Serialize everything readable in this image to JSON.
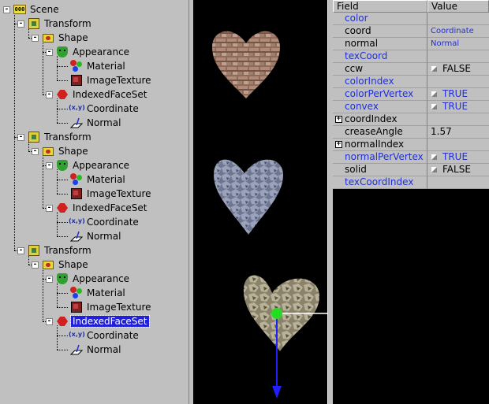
{
  "tree": {
    "nodes": [
      {
        "label": "Scene",
        "icon": "scene-icon",
        "expander": "-"
      },
      {
        "label": "Transform",
        "icon": "transform-icon",
        "expander": "-"
      },
      {
        "label": "Shape",
        "icon": "shape-icon",
        "expander": "-"
      },
      {
        "label": "Appearance",
        "icon": "appearance-icon",
        "expander": "-"
      },
      {
        "label": "Material",
        "icon": "material-icon"
      },
      {
        "label": "ImageTexture",
        "icon": "image-texture-icon"
      },
      {
        "label": "IndexedFaceSet",
        "icon": "indexed-face-set-icon",
        "expander": "-"
      },
      {
        "label": "Coordinate",
        "icon": "coordinate-icon"
      },
      {
        "label": "Normal",
        "icon": "normal-icon"
      },
      {
        "label": "Transform",
        "icon": "transform-icon",
        "expander": "-"
      },
      {
        "label": "Shape",
        "icon": "shape-icon",
        "expander": "-"
      },
      {
        "label": "Appearance",
        "icon": "appearance-icon",
        "expander": "-"
      },
      {
        "label": "Material",
        "icon": "material-icon"
      },
      {
        "label": "ImageTexture",
        "icon": "image-texture-icon"
      },
      {
        "label": "IndexedFaceSet",
        "icon": "indexed-face-set-icon",
        "expander": "-"
      },
      {
        "label": "Coordinate",
        "icon": "coordinate-icon"
      },
      {
        "label": "Normal",
        "icon": "normal-icon"
      },
      {
        "label": "Transform",
        "icon": "transform-icon",
        "expander": "-"
      },
      {
        "label": "Shape",
        "icon": "shape-icon",
        "expander": "-"
      },
      {
        "label": "Appearance",
        "icon": "appearance-icon",
        "expander": "-"
      },
      {
        "label": "Material",
        "icon": "material-icon"
      },
      {
        "label": "ImageTexture",
        "icon": "image-texture-icon"
      },
      {
        "label": "IndexedFaceSet",
        "icon": "indexed-face-set-icon",
        "expander": "-",
        "selected": true
      },
      {
        "label": "Coordinate",
        "icon": "coordinate-icon"
      },
      {
        "label": "Normal",
        "icon": "normal-icon"
      }
    ],
    "scene_icon_text": "000",
    "coordinate_icon_text": "(x,y)"
  },
  "viewer": {
    "objects": [
      "brick-heart",
      "slate-heart",
      "stone-heart"
    ],
    "selected_object": "stone-heart"
  },
  "fields": {
    "header_field": "Field",
    "header_value": "Value",
    "rows": [
      {
        "name": "color",
        "value": "",
        "blue": true
      },
      {
        "name": "coord",
        "value": "Coordinate",
        "value_blue": true,
        "value_small": true
      },
      {
        "name": "normal",
        "value": "Normal",
        "value_blue": true,
        "value_small": true
      },
      {
        "name": "texCoord",
        "value": "",
        "blue": true
      },
      {
        "name": "ccw",
        "value": "FALSE",
        "toggle": true
      },
      {
        "name": "colorIndex",
        "value": "",
        "blue": true
      },
      {
        "name": "colorPerVertex",
        "value": "TRUE",
        "toggle": true,
        "blue": true,
        "value_blue": true
      },
      {
        "name": "convex",
        "value": "TRUE",
        "toggle": true,
        "blue": true,
        "value_blue": true
      },
      {
        "name": "coordIndex",
        "value": "",
        "plus": true
      },
      {
        "name": "creaseAngle",
        "value": "1.57"
      },
      {
        "name": "normalIndex",
        "value": "",
        "plus": true
      },
      {
        "name": "normalPerVertex",
        "value": "TRUE",
        "toggle": true,
        "blue": true,
        "value_blue": true
      },
      {
        "name": "solid",
        "value": "FALSE",
        "toggle": true
      },
      {
        "name": "texCoordIndex",
        "value": "",
        "blue": true
      }
    ]
  },
  "colors": {
    "selection": "#2020d8",
    "default_field_blue": "#2030d0",
    "panel_gray": "#c0c0c0",
    "viewer_bg": "#000000"
  }
}
